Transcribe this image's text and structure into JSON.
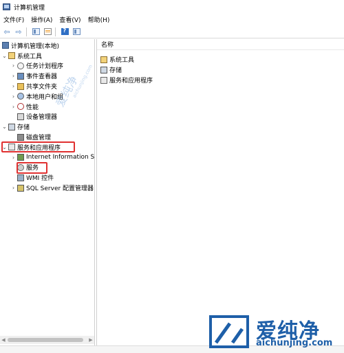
{
  "window": {
    "title": "计算机管理"
  },
  "menu": [
    "文件(F)",
    "操作(A)",
    "查看(V)",
    "帮助(H)"
  ],
  "toolbar": {
    "icons": [
      "back-arrow-icon",
      "forward-arrow-icon",
      "show-hide-tree-icon",
      "export-list-icon",
      "help-icon",
      "properties-icon"
    ]
  },
  "tree": {
    "root": "计算机管理(本地)",
    "system_tools": "系统工具",
    "task_scheduler": "任务计划程序",
    "event_viewer": "事件查看器",
    "shared_folders": "共享文件夹",
    "local_users": "本地用户和组",
    "performance": "性能",
    "device_manager": "设备管理器",
    "storage": "存储",
    "disk_management": "磁盘管理",
    "services_apps": "服务和应用程序",
    "iis": "Internet Information S",
    "services": "服务",
    "wmi": "WMI 控件",
    "sql": "SQL Server 配置管理器"
  },
  "list": {
    "column_name": "名称",
    "items": [
      "系统工具",
      "存储",
      "服务和应用程序"
    ]
  },
  "watermark": {
    "cn": "爱纯净",
    "url": "aichunjing.com",
    "diagonal_cn": "爱纯净",
    "diagonal_url": "aichunjing.com"
  },
  "colors": {
    "highlight": "#e03030",
    "accent": "#1e5fa8"
  }
}
